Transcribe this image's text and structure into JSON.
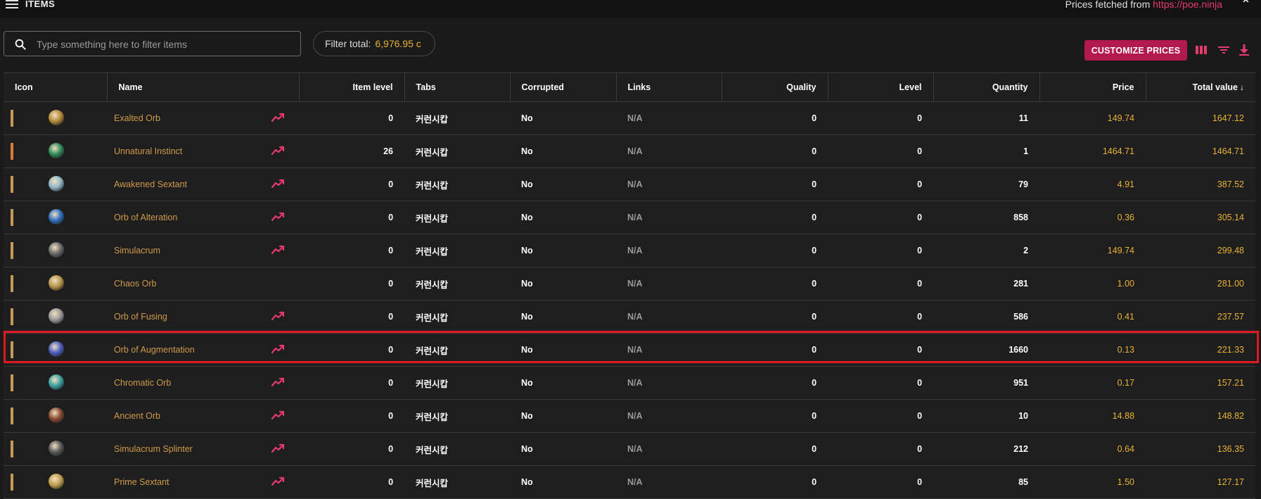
{
  "topbar": {
    "title": "ITEMS",
    "prices_fetched_prefix": "Prices fetched from",
    "prices_fetched_link": "https://poe.ninja"
  },
  "search": {
    "placeholder": "Type something here to filter items"
  },
  "filter_total": {
    "label": "Filter total:",
    "value": "6,976.95 c"
  },
  "toolbar": {
    "customize_label": "CUSTOMIZE PRICES"
  },
  "table": {
    "headers": {
      "icon": "Icon",
      "name": "Name",
      "item_level": "Item level",
      "tabs": "Tabs",
      "corrupted": "Corrupted",
      "links": "Links",
      "quality": "Quality",
      "level": "Level",
      "quantity": "Quantity",
      "price": "Price",
      "total_value": "Total value"
    },
    "sort_indicator": "↓",
    "rows": [
      {
        "name": "Exalted Orb",
        "item_level": "0",
        "tab": "커런시캅",
        "corrupted": "No",
        "links": "N/A",
        "quality": "0",
        "level": "0",
        "quantity": "11",
        "price": "149.74",
        "total": "1647.12",
        "rarity": "#c29a55",
        "icon_color": "#b58a3a",
        "trend": true
      },
      {
        "name": "Unnatural Instinct",
        "item_level": "26",
        "tab": "커런시캅",
        "corrupted": "No",
        "links": "N/A",
        "quality": "0",
        "level": "0",
        "quantity": "1",
        "price": "1464.71",
        "total": "1464.71",
        "rarity": "#d77a3a",
        "icon_color": "#2f8a5a",
        "trend": true
      },
      {
        "name": "Awakened Sextant",
        "item_level": "0",
        "tab": "커런시캅",
        "corrupted": "No",
        "links": "N/A",
        "quality": "0",
        "level": "0",
        "quantity": "79",
        "price": "4.91",
        "total": "387.52",
        "rarity": "#c29a55",
        "icon_color": "#8fb6c8",
        "trend": true
      },
      {
        "name": "Orb of Alteration",
        "item_level": "0",
        "tab": "커런시캅",
        "corrupted": "No",
        "links": "N/A",
        "quality": "0",
        "level": "0",
        "quantity": "858",
        "price": "0.36",
        "total": "305.14",
        "rarity": "#c29a55",
        "icon_color": "#2f6fc0",
        "trend": true
      },
      {
        "name": "Simulacrum",
        "item_level": "0",
        "tab": "커런시캅",
        "corrupted": "No",
        "links": "N/A",
        "quality": "0",
        "level": "0",
        "quantity": "2",
        "price": "149.74",
        "total": "299.48",
        "rarity": "#c29a55",
        "icon_color": "#6b6b6b",
        "trend": true
      },
      {
        "name": "Chaos Orb",
        "item_level": "0",
        "tab": "커런시캅",
        "corrupted": "No",
        "links": "N/A",
        "quality": "0",
        "level": "0",
        "quantity": "281",
        "price": "1.00",
        "total": "281.00",
        "rarity": "#c29a55",
        "icon_color": "#b8964a",
        "trend": false
      },
      {
        "name": "Orb of Fusing",
        "item_level": "0",
        "tab": "커런시캅",
        "corrupted": "No",
        "links": "N/A",
        "quality": "0",
        "level": "0",
        "quantity": "586",
        "price": "0.41",
        "total": "237.57",
        "rarity": "#c29a55",
        "icon_color": "#9a9a9a",
        "trend": true
      },
      {
        "name": "Orb of Augmentation",
        "item_level": "0",
        "tab": "커런시캅",
        "corrupted": "No",
        "links": "N/A",
        "quality": "0",
        "level": "0",
        "quantity": "1660",
        "price": "0.13",
        "total": "221.33",
        "rarity": "#c29a55",
        "icon_color": "#4a5ec0",
        "trend": true
      },
      {
        "name": "Chromatic Orb",
        "item_level": "0",
        "tab": "커런시캅",
        "corrupted": "No",
        "links": "N/A",
        "quality": "0",
        "level": "0",
        "quantity": "951",
        "price": "0.17",
        "total": "157.21",
        "rarity": "#c29a55",
        "icon_color": "#3aa0a0",
        "trend": true
      },
      {
        "name": "Ancient Orb",
        "item_level": "0",
        "tab": "커런시캅",
        "corrupted": "No",
        "links": "N/A",
        "quality": "0",
        "level": "0",
        "quantity": "10",
        "price": "14.88",
        "total": "148.82",
        "rarity": "#c29a55",
        "icon_color": "#8a4a32",
        "trend": true
      },
      {
        "name": "Simulacrum Splinter",
        "item_level": "0",
        "tab": "커런시캅",
        "corrupted": "No",
        "links": "N/A",
        "quality": "0",
        "level": "0",
        "quantity": "212",
        "price": "0.64",
        "total": "136.35",
        "rarity": "#c29a55",
        "icon_color": "#5a5a5a",
        "trend": true
      },
      {
        "name": "Prime Sextant",
        "item_level": "0",
        "tab": "커런시캅",
        "corrupted": "No",
        "links": "N/A",
        "quality": "0",
        "level": "0",
        "quantity": "85",
        "price": "1.50",
        "total": "127.17",
        "rarity": "#c29a55",
        "icon_color": "#c0a050",
        "trend": true
      }
    ]
  },
  "colors": {
    "accent": "#b3194e",
    "link": "#e63a6e",
    "gold": "#e9b233",
    "item_name": "#cf9a4a",
    "highlight": "#e01a22"
  }
}
